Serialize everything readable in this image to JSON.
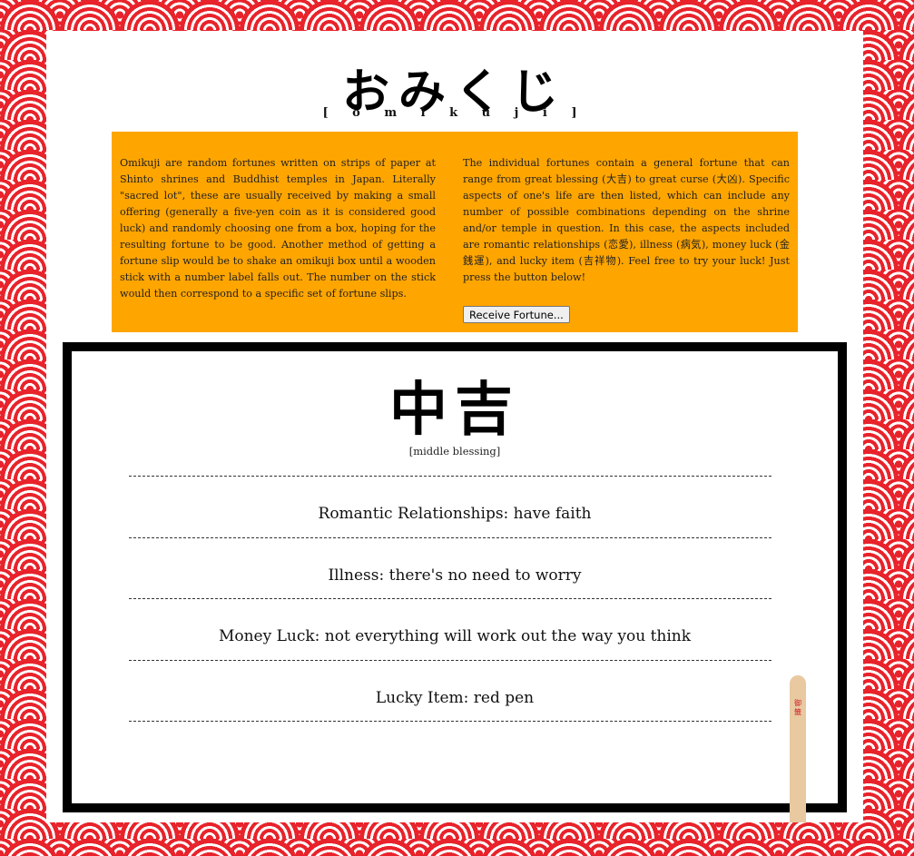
{
  "header": {
    "title": "おみくじ",
    "romaji": "[ o m i k u j i ]"
  },
  "info": {
    "left_text": "Omikuji are random fortunes written on strips of paper at Shinto shrines and Buddhist temples in Japan. Literally \"sacred lot\", these are usually received by making a small offering (generally a five-yen coin as it is considered good luck) and randomly choosing one from a box, hoping for the resulting fortune to be good. Another method of getting a fortune slip would be to shake an omikuji box until a wooden stick with a number label falls out. The number on the stick would then correspond to a specific set of fortune slips.",
    "right_text": "The individual fortunes contain a general fortune that can range from great blessing (大吉) to great curse (大凶). Specific aspects of one's life are then listed, which can include any number of possible combinations depending on the shrine and/or temple in question. In this case, the aspects included are romantic relationships (恋愛), illness (病気), money luck (金銭運), and lucky item (吉祥物). Feel free to try your luck! Just press the button below!",
    "button_label": "Receive Fortune..."
  },
  "fortune": {
    "title": "中吉",
    "subtitle": "[middle blessing]",
    "divider": "-----------------------------------------------------------------------------------------------------------------------------",
    "aspects": [
      "Romantic Relationships: have faith",
      "Illness: there's no need to worry",
      "Money Luck: not everything will work out the way you think",
      "Lucky Item: red pen"
    ]
  },
  "stick": {
    "label": "御\n籤"
  },
  "colors": {
    "background_red": "#e8232b",
    "info_orange": "#ffa500",
    "stick_wood": "#e8c9a0"
  }
}
